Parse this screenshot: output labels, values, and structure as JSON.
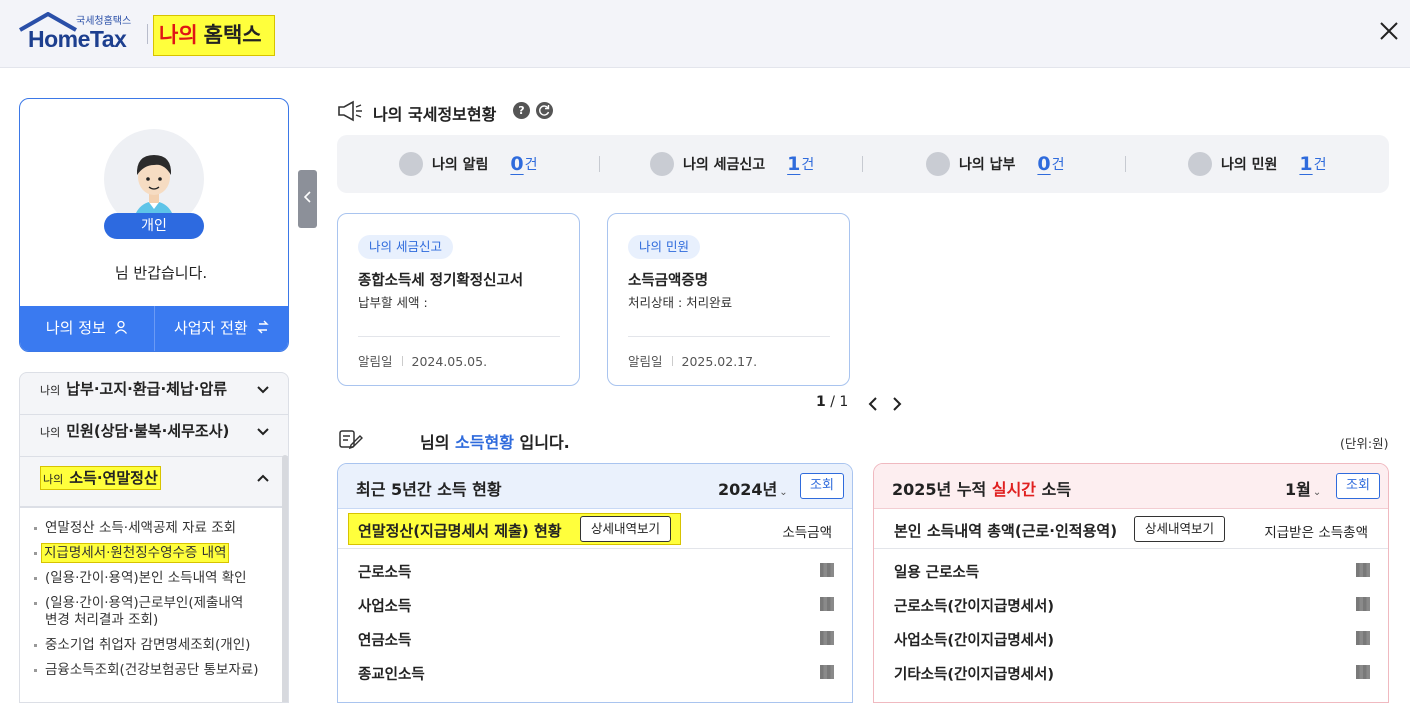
{
  "header": {
    "logo_small": "국세청홈택스",
    "logo_main": "HomeTax",
    "title_part1": "나의",
    "title_part2": "홈택스"
  },
  "profile": {
    "badge": "개인",
    "greeting": "님 반갑습니다.",
    "my_info_button": "나의 정보",
    "switch_button": "사업자 전환"
  },
  "menu": {
    "items": [
      {
        "prefix": "나의",
        "label": "납부·고지·환급·체납·압류"
      },
      {
        "prefix": "나의",
        "label": "민원(상담·불복·세무조사)"
      },
      {
        "prefix": "나의",
        "label": "소득·연말정산"
      }
    ],
    "sub_items": [
      "연말정산 소득·세액공제 자료 조회",
      "지급명세서·원천징수영수증 내역",
      "(일용·간이·용역)본인 소득내역 확인",
      "(일용·간이·용역)근로부인(제출내역 변경 처리결과 조회)",
      "중소기업 취업자 감면명세조회(개인)",
      "금융소득조회(건강보험공단 통보자료)"
    ]
  },
  "status": {
    "title": "나의 국세정보현황",
    "help": "?",
    "items": [
      {
        "label": "나의 알림",
        "count": "0",
        "unit": "건"
      },
      {
        "label": "나의 세금신고",
        "count": "1",
        "unit": "건"
      },
      {
        "label": "나의 납부",
        "count": "0",
        "unit": "건"
      },
      {
        "label": "나의 민원",
        "count": "1",
        "unit": "건"
      }
    ]
  },
  "cards": [
    {
      "tag": "나의 세금신고",
      "title": "종합소득세 정기확정신고서",
      "sub": "납부할 세액 :",
      "date_label": "알림일",
      "date": "2024.05.05."
    },
    {
      "tag": "나의 민원",
      "title": "소득금액증명",
      "sub": "처리상태 : 처리완료",
      "date_label": "알림일",
      "date": "2025.02.17."
    }
  ],
  "pager": {
    "current": "1",
    "total": "/ 1"
  },
  "income": {
    "title_pre": "님의",
    "title_blue": "소득현황",
    "title_post": "입니다.",
    "unit_note": "(단위:원)"
  },
  "panel_left": {
    "title": "최근 5년간 소득 현황",
    "year": "2024년",
    "query_button": "조회",
    "sub_label": "연말정산(지급명세서 제출) 현황",
    "detail_button": "상세내역보기",
    "right_label": "소득금액",
    "rows": [
      "근로소득",
      "사업소득",
      "연금소득",
      "종교인소득"
    ]
  },
  "panel_right": {
    "title_pre": "2025년 누적",
    "title_red": "실시간",
    "title_post": "소득",
    "month": "1월",
    "query_button": "조회",
    "sub_label": "본인 소득내역 총액(근로·인적용역)",
    "detail_button": "상세내역보기",
    "right_label": "지급받은 소득총액",
    "rows": [
      "일용 근로소득",
      "근로소득(간이지급명세서)",
      "사업소득(간이지급명세서)",
      "기타소득(간이지급명세서)"
    ]
  },
  "colors": {
    "accent": "#2f6bdc",
    "highlight": "#ffff3c",
    "brand": "#1d3f8f"
  }
}
